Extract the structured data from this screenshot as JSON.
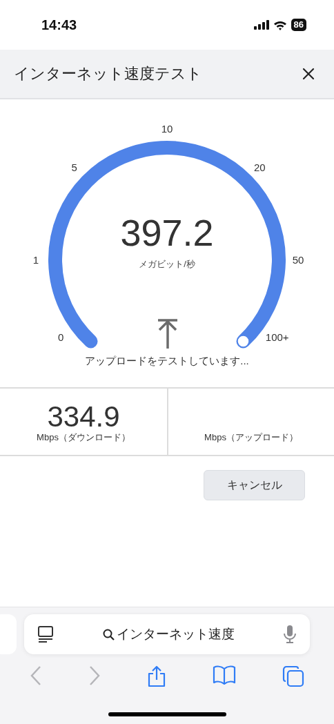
{
  "status_bar": {
    "time": "14:43",
    "battery": "86"
  },
  "header": {
    "title": "インターネット速度テスト"
  },
  "gauge": {
    "reading": "397.2",
    "unit": "メガビット/秒",
    "status": "アップロードをテストしています...",
    "ticks": [
      "0",
      "1",
      "5",
      "10",
      "20",
      "50",
      "100+"
    ]
  },
  "results": [
    {
      "value": "334.9",
      "label": "Mbps（ダウンロード）"
    },
    {
      "label": "Mbps（アップロード）"
    }
  ],
  "cancel_button": "キャンセル",
  "browser": {
    "address": "インターネット速度",
    "back": {
      "disabled": true
    },
    "forward": {
      "disabled": true
    }
  }
}
